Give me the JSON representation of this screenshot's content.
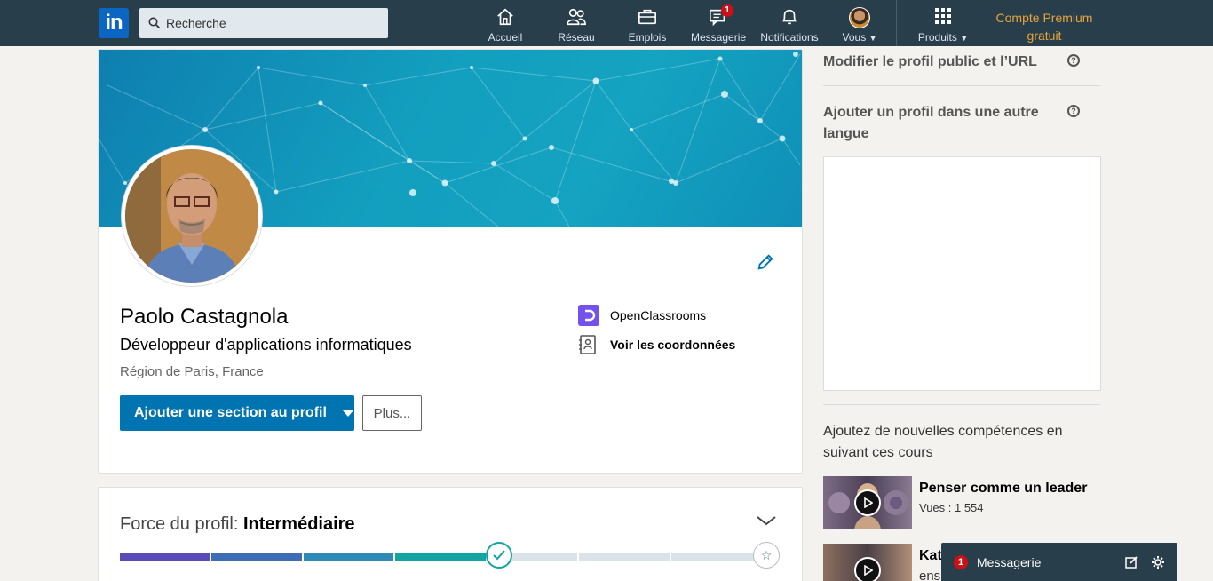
{
  "nav": {
    "logo": "in",
    "search_placeholder": "Recherche",
    "items": [
      {
        "label": "Accueil"
      },
      {
        "label": "Réseau"
      },
      {
        "label": "Emplois"
      },
      {
        "label": "Messagerie",
        "badge": "1"
      },
      {
        "label": "Notifications"
      },
      {
        "label": "Vous"
      },
      {
        "label": "Produits"
      }
    ],
    "premium_line1": "Compte Premium",
    "premium_line2": "gratuit"
  },
  "profile": {
    "name": "Paolo Castagnola",
    "headline": "Développeur d'applications informatiques",
    "location": "Région de Paris, France",
    "add_section_label": "Ajouter une section au profil",
    "more_label": "Plus...",
    "company": "OpenClassrooms",
    "contact_label": "Voir les coordonnées"
  },
  "strength": {
    "label": "Force du profil:",
    "level": "Intermédiaire",
    "progress": 0.5714
  },
  "rail": {
    "edit_public_profile": "Modifier le profil public et l’URL",
    "add_language_profile": "Ajouter un profil dans une autre langue",
    "help_glyph": "?",
    "courses_title": "Ajoutez de nouvelles compétences en suivant ces cours",
    "courses": [
      {
        "title": "Penser comme un leader",
        "views": "Vues : 1 554"
      },
      {
        "title": "Katr",
        "views": "ens"
      }
    ]
  },
  "messaging": {
    "label": "Messagerie",
    "badge": "1"
  },
  "colors": {
    "nav_bg": "#283e4a",
    "primary": "#0073b1",
    "premium": "#e7a33e",
    "badge": "#cc1016",
    "progress_seg1": "#5b4bb6",
    "progress_seg2": "#3d6db4",
    "progress_seg3": "#2f8ab6",
    "progress_seg4": "#13a3a3"
  }
}
